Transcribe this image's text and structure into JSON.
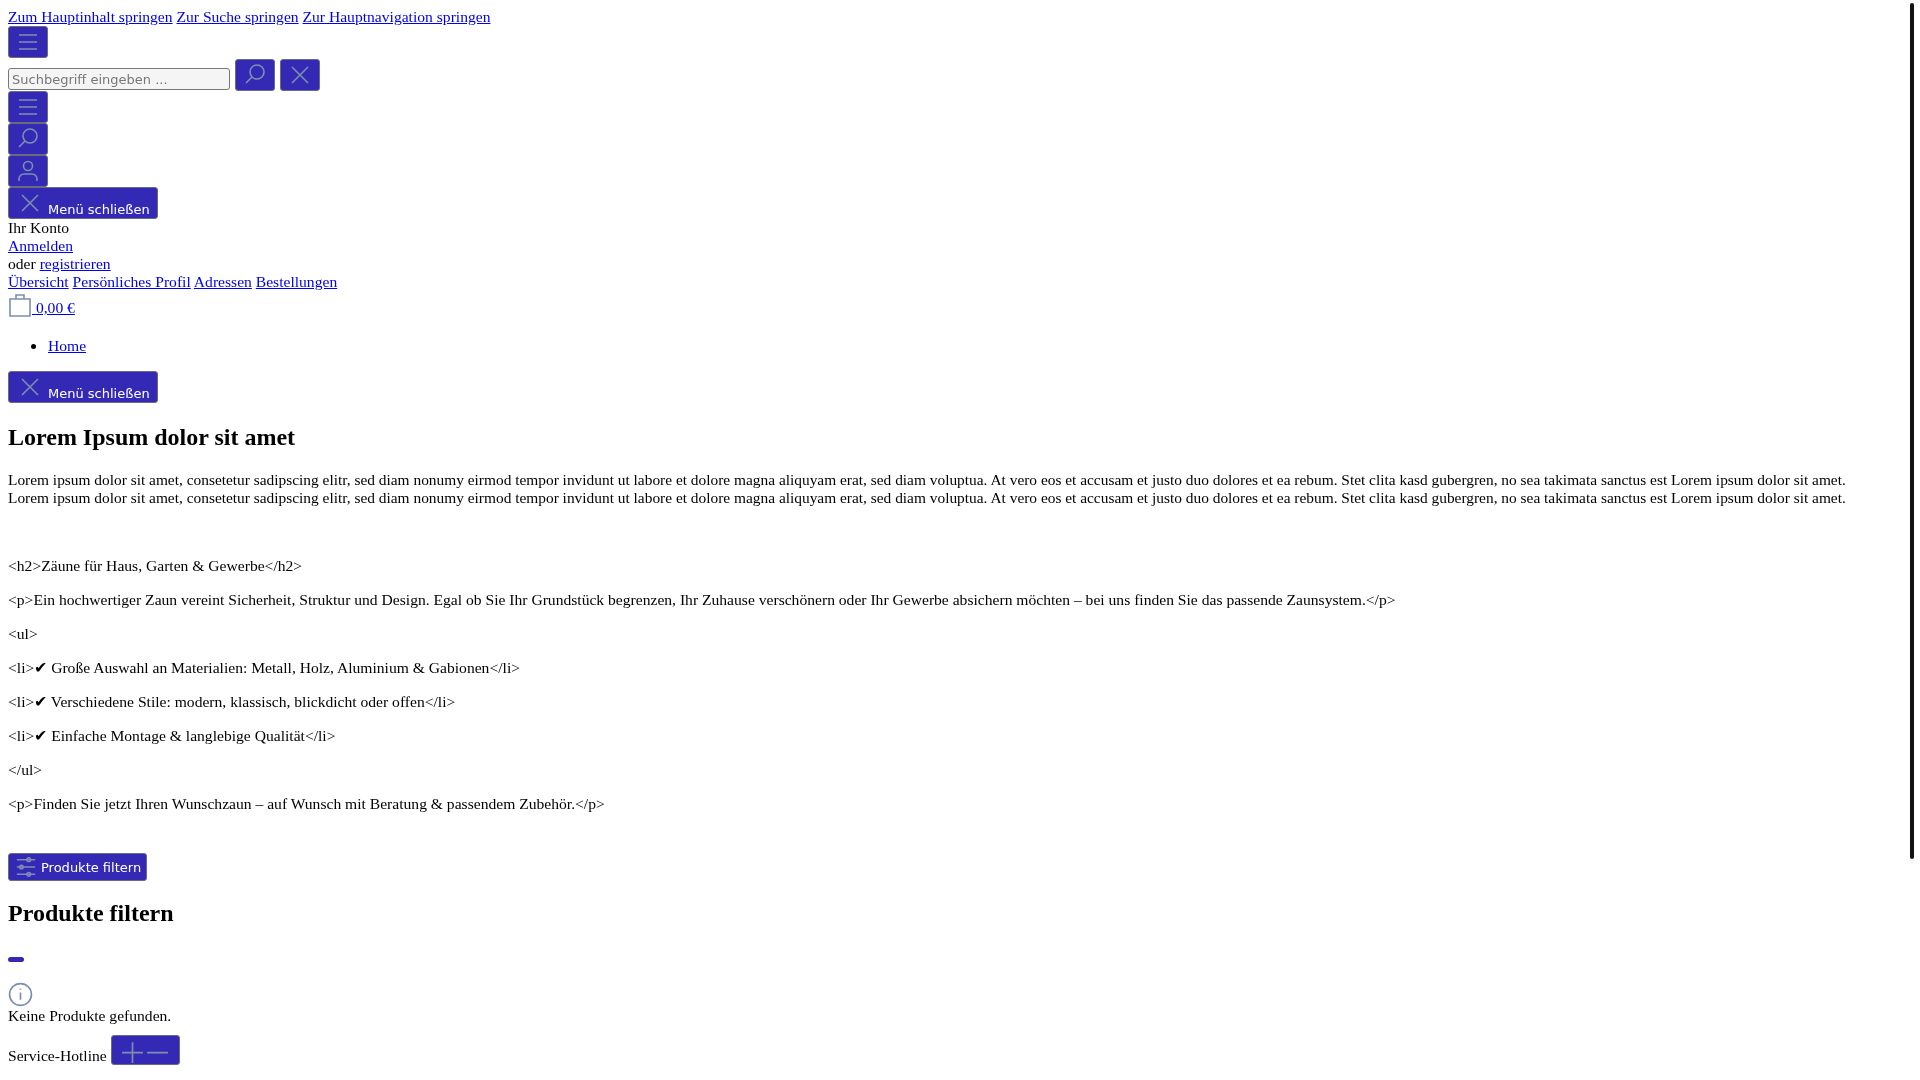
{
  "skip_links": [
    "Zum Hauptinhalt springen",
    "Zur Suche springen",
    "Zur Hauptnavigation springen"
  ],
  "search": {
    "placeholder": "Suchbegriff eingeben ..."
  },
  "close_menu_label": "Menü schließen",
  "account": {
    "title": "Ihr Konto",
    "login": "Anmelden",
    "or_text": "oder",
    "register": "registrieren",
    "links": [
      "Übersicht",
      "Persönliches Profil",
      "Adressen",
      "Bestellungen"
    ]
  },
  "cart": {
    "total": "0,00 €"
  },
  "breadcrumb": [
    "Home"
  ],
  "close_menu_label_2": "Menü schließen",
  "content": {
    "heading": "Lorem Ipsum dolor sit amet",
    "paragraph_lines": [
      "Lorem ipsum dolor sit amet, consetetur sadipscing elitr, sed diam nonumy eirmod tempor invidunt ut labore et dolore magna aliquyam erat, sed diam voluptua. At vero eos et accusam et justo duo dolores et ea rebum. Stet clita kasd gubergren, no sea takimata sanctus est Lorem ipsum dolor sit amet.",
      "Lorem ipsum dolor sit amet, consetetur sadipscing elitr, sed diam nonumy eirmod tempor invidunt ut labore et dolore magna aliquyam erat, sed diam voluptua. At vero eos et accusam et justo duo dolores et ea rebum. Stet clita kasd gubergren, no sea takimata sanctus est Lorem ipsum dolor sit amet."
    ],
    "raw_lines": [
      "<h2>Zäune für Haus, Garten & Gewerbe</h2>",
      "<p>Ein hochwertiger Zaun vereint Sicherheit, Struktur und Design. Egal ob Sie Ihr Grundstück begrenzen, Ihr Zuhause verschönern oder Ihr Gewerbe absichern möchten – bei uns finden Sie das passende Zaunsystem.</p>",
      "<ul>",
      "<li>✔ Große Auswahl an Materialien: Metall, Holz, Aluminium & Gabionen</li>",
      "<li>✔ Verschiedene Stile: modern, klassisch, blickdicht oder offen</li>",
      "<li>✔ Einfache Montage & langlebige Qualität</li>",
      "</ul>",
      "<p>Finden Sie jetzt Ihren Wunschzaun – auf Wunsch mit Beratung & passendem Zubehör.</p>"
    ]
  },
  "filter": {
    "button_label": "Produkte filtern",
    "heading": "Produkte filtern",
    "empty_message": "Keine Produkte gefunden."
  },
  "footer": {
    "hotline_label": "Service-Hotline"
  }
}
